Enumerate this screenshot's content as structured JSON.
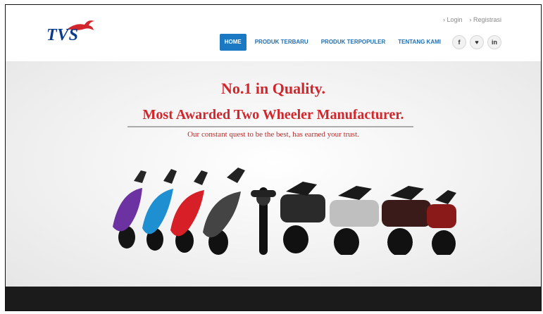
{
  "brand": {
    "logo_text": "TVS"
  },
  "header": {
    "links": [
      "› Login",
      "› Registrasi"
    ],
    "nav": [
      {
        "label": "HOME",
        "active": true
      },
      {
        "label": "PRODUK TERBARU",
        "active": false
      },
      {
        "label": "PRODUK TERPOPULER",
        "active": false
      },
      {
        "label": "TENTANG KAMI",
        "active": false
      }
    ],
    "social": [
      {
        "label": "f",
        "icon": "facebook-icon"
      },
      {
        "label": "♥",
        "icon": "twitter-icon"
      },
      {
        "label": "in",
        "icon": "linkedin-icon"
      }
    ]
  },
  "hero": {
    "headline": "No.1 in Quality.",
    "subheadline": "Most Awarded Two Wheeler Manufacturer.",
    "tagline": "Our constant quest to be the best, has earned your trust."
  },
  "colors": {
    "brand_red": "#d1262c",
    "nav_blue": "#1b78c2",
    "logo_blue": "#0b3b8a",
    "footer_bg": "#1b1b1b"
  }
}
